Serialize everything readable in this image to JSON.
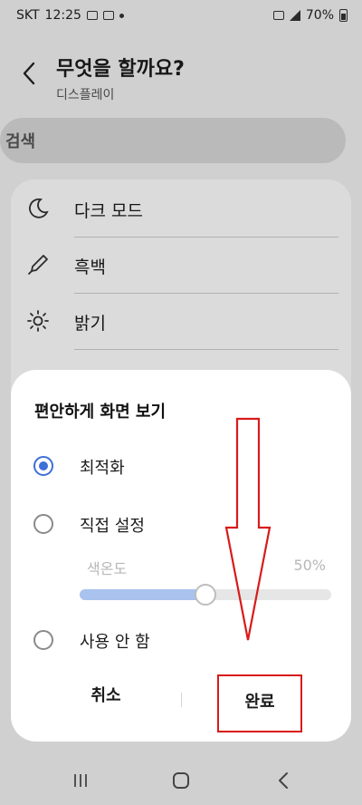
{
  "status": {
    "carrier": "SKT",
    "time": "12:25",
    "battery": "70%"
  },
  "header": {
    "title": "무엇을 할까요?",
    "subtitle": "디스플레이"
  },
  "search": {
    "label": "검색"
  },
  "settings": {
    "items": [
      {
        "label": "다크 모드",
        "icon": "moon-icon"
      },
      {
        "label": "흑백",
        "icon": "eyedropper-icon"
      },
      {
        "label": "밝기",
        "icon": "sun-icon"
      }
    ]
  },
  "dialog": {
    "title": "편안하게 화면 보기",
    "options": [
      {
        "label": "최적화",
        "selected": true
      },
      {
        "label": "직접 설정",
        "selected": false
      },
      {
        "label": "사용 안 함",
        "selected": false
      }
    ],
    "slider": {
      "label": "색온도",
      "value_text": "50%",
      "value": 0.5
    },
    "cancel_label": "취소",
    "done_label": "완료"
  },
  "annotation": {
    "color": "#d81b1b"
  },
  "colors": {
    "accent": "#3e6fd8"
  }
}
